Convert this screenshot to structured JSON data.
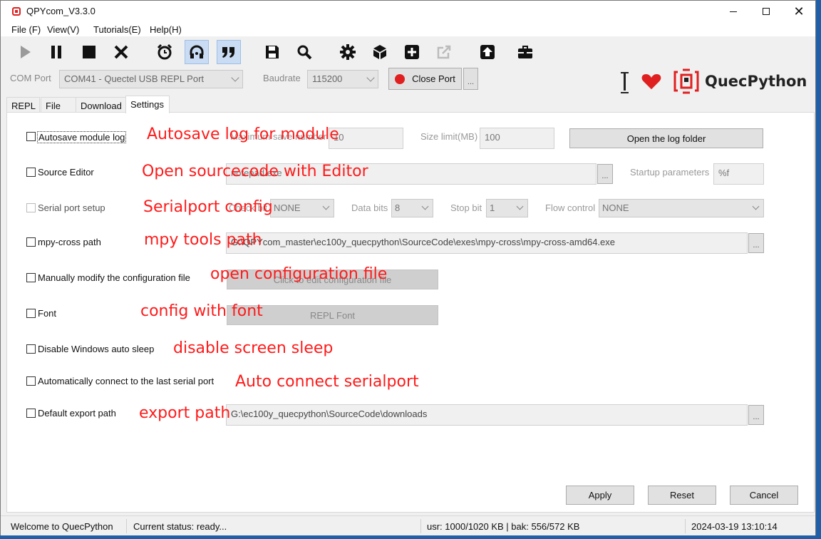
{
  "window": {
    "title": "QPYcom_V3.3.0"
  },
  "menu": [
    "File (F)",
    "View(V)",
    "Tutorials(E)",
    "Help(H)"
  ],
  "toolbar": {
    "icons": [
      "play-icon",
      "pause-icon",
      "stop-icon",
      "close-icon",
      "alarm-clock-icon",
      "headset-icon",
      "quote-icon",
      "save-icon",
      "search-icon",
      "gear-icon",
      "cube-icon",
      "add-icon",
      "export-icon",
      "upload-icon",
      "toolbox-icon"
    ]
  },
  "port": {
    "com_label": "COM Port",
    "com_value": "COM41 - Quectel USB REPL Port",
    "baud_label": "Baudrate",
    "baud_value": "115200",
    "close_port": "Close Port",
    "more": "..."
  },
  "brand": {
    "name": "QuecPython",
    "accent": "#e02020"
  },
  "tabs": [
    "REPL",
    "File",
    "Download",
    "Settings"
  ],
  "settings": {
    "autosave": {
      "label": "Autosave module log",
      "max_num_label": "Maximum save number",
      "max_num_value": "10",
      "size_label": "Size limit(MB)",
      "size_value": "100",
      "open_folder": "Open the log folder",
      "annotation": "Autosave log for module"
    },
    "source_editor": {
      "label": "Source Editor",
      "path": "notepad.exe",
      "more": "...",
      "startup_label": "Startup parameters",
      "startup_value": "%f",
      "annotation": "Open sourcecode with Editor"
    },
    "serial": {
      "label": "Serial port setup",
      "check_label": "Check bit",
      "check_value": "NONE",
      "data_label": "Data bits",
      "data_value": "8",
      "stop_label": "Stop bit",
      "stop_value": "1",
      "flow_label": "Flow control",
      "flow_value": "NONE",
      "annotation": "Serialport config"
    },
    "mpy_cross": {
      "label": "mpy-cross path",
      "path": "G:\\QPYcom_master\\ec100y_quecpython\\SourceCode\\exes\\mpy-cross\\mpy-cross-amd64.exe",
      "more": "...",
      "annotation": "mpy tools path"
    },
    "config_file": {
      "label": "Manually modify the configuration file",
      "button": "Click to edit configuration file",
      "annotation": "open configuration file"
    },
    "font": {
      "label": "Font",
      "button": "REPL Font",
      "annotation": "config with font"
    },
    "sleep": {
      "label": "Disable Windows auto sleep",
      "annotation": "disable screen sleep"
    },
    "auto_connect": {
      "label": "Automatically connect to the last serial port",
      "annotation": "Auto connect serialport"
    },
    "export": {
      "label": "Default export path",
      "path": "G:\\ec100y_quecpython\\SourceCode\\downloads",
      "more": "...",
      "annotation": "export path"
    }
  },
  "actions": {
    "apply": "Apply",
    "reset": "Reset",
    "cancel": "Cancel"
  },
  "status": {
    "welcome": "Welcome to QuecPython",
    "current": "Current status: ready...",
    "memory": "usr: 1000/1020 KB | bak: 556/572 KB",
    "datetime": "2024-03-19 13:10:14"
  }
}
